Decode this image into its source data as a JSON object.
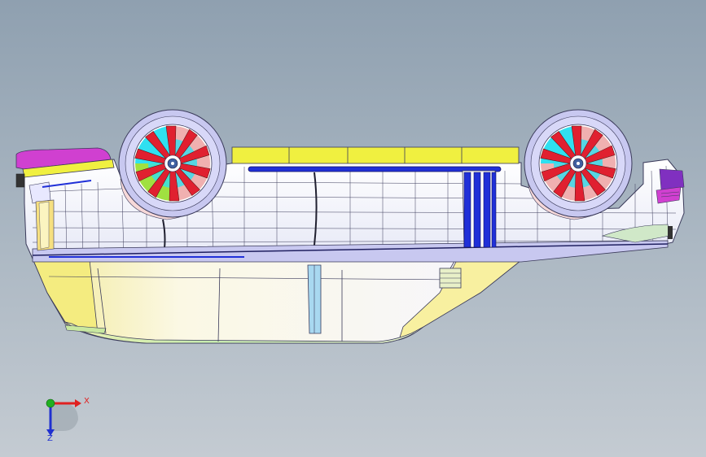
{
  "viewport": {
    "background_top": "#8fa0b0",
    "background_bottom": "#c4cbd2",
    "model_view": "car-body-upside-down-side-view"
  },
  "triad": {
    "x_label": "X",
    "z_label": "Z",
    "x_color": "#e02020",
    "y_color": "#20b020",
    "z_color": "#2030d0"
  },
  "model": {
    "body_color": "#fafaff",
    "panel_line_color": "#3a3a5a",
    "rocker_color": "#c8c8f0",
    "lower_panel_color": "#f6f0a0",
    "trim_color": "#f0f040",
    "rail_color": "#2030d8",
    "tire_color": "#c8c8f0",
    "spoke_red": "#e02030",
    "hub_cyan": "#30e0f0",
    "hub_green": "#a0e040",
    "hub_pink": "#f0b0b0",
    "cap_magenta": "#d040d0"
  }
}
